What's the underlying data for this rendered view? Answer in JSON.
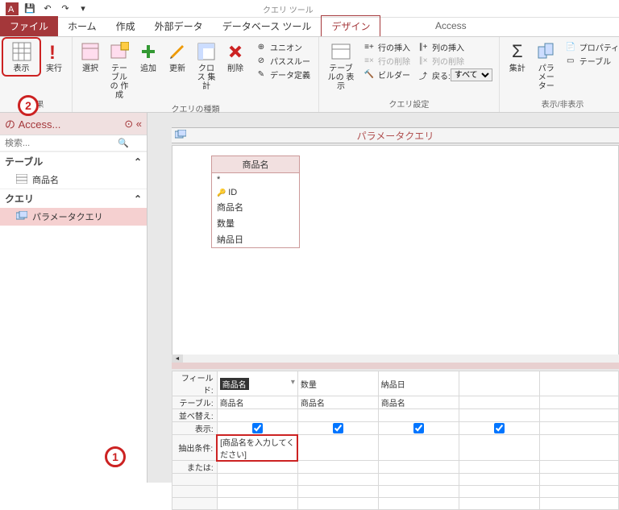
{
  "qat": {
    "save": "💾",
    "undo": "↶",
    "redo": "↷"
  },
  "tabs": {
    "file": "ファイル",
    "home": "ホーム",
    "create": "作成",
    "external": "外部データ",
    "dbtools": "データベース ツール",
    "design": "デザイン",
    "tools_ctx": "クエリ ツール",
    "app_title": "Access"
  },
  "ribbon": {
    "results": {
      "view": "表示",
      "run": "実行",
      "label": "結果"
    },
    "qtype": {
      "select": "選択",
      "maketable": "テーブルの\n作成",
      "append": "追加",
      "update": "更新",
      "crosstab": "クロス\n集計",
      "delete": "削除",
      "union": "ユニオン",
      "passthrough": "パススルー",
      "datadef": "データ定義",
      "label": "クエリの種類"
    },
    "qsetup": {
      "showtable": "テーブルの\n表示",
      "insertrow": "行の挿入",
      "deleterow": "行の削除",
      "builder": "ビルダー",
      "insertcol": "列の挿入",
      "deletecol": "列の削除",
      "return": "戻る:",
      "return_val": "すべて",
      "label": "クエリ設定"
    },
    "showhide": {
      "totals": "集計",
      "params": "パラメーター",
      "propsheet": "プロパティ",
      "tablenames": "テーブル",
      "label": "表示/非表示"
    }
  },
  "nav": {
    "title": "の Access...",
    "search_ph": "検索...",
    "cat_table": "テーブル",
    "item_table": "商品名",
    "cat_query": "クエリ",
    "item_query": "パラメータクエリ"
  },
  "query": {
    "tab_title": "パラメータクエリ",
    "table": {
      "name": "商品名",
      "star": "*",
      "fields": [
        "ID",
        "商品名",
        "数量",
        "納品日"
      ]
    },
    "grid": {
      "rows": {
        "field": "フィールド:",
        "table": "テーブル:",
        "sort": "並べ替え:",
        "show": "表示:",
        "criteria": "抽出条件:",
        "or": "または:"
      },
      "cols": [
        {
          "field": "商品名",
          "table": "商品名",
          "show": true,
          "criteria": "[商品名を入力してください]"
        },
        {
          "field": "数量",
          "table": "商品名",
          "show": true,
          "criteria": ""
        },
        {
          "field": "納品日",
          "table": "商品名",
          "show": true,
          "criteria": ""
        },
        {
          "field": "",
          "table": "",
          "show": true,
          "criteria": ""
        }
      ]
    }
  },
  "callouts": {
    "c1": "1",
    "c2": "2"
  }
}
